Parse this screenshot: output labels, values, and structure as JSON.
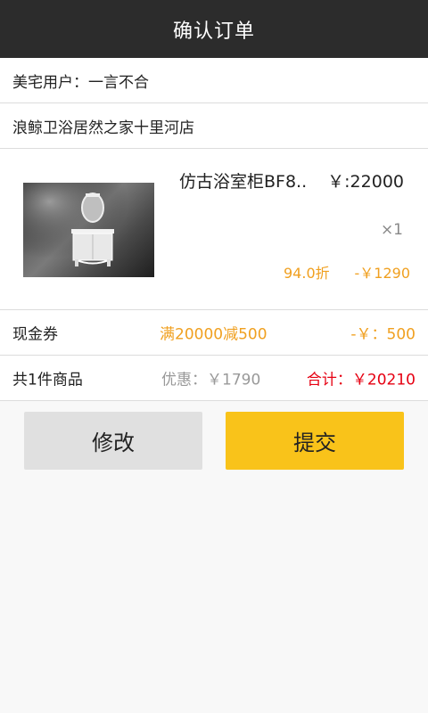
{
  "header": {
    "title": "确认订单"
  },
  "user": {
    "label": "美宅用户：",
    "name": "一言不合"
  },
  "store": {
    "name": "浪鲸卫浴居然之家十里河店"
  },
  "product": {
    "name": "仿古浴室柜BF8..",
    "price": "￥:22000",
    "qty": "×1",
    "discount": "94.0折",
    "discount_amount": "-￥1290"
  },
  "coupon": {
    "label": "现金券",
    "rule": "满20000减500",
    "amount": "-￥：500"
  },
  "total": {
    "count": "共1件商品",
    "saving": "优惠：￥1790",
    "sum": "合计：￥20210"
  },
  "actions": {
    "edit": "修改",
    "submit": "提交"
  },
  "colors": {
    "accent": "#f9c31a",
    "orange": "#f0a020",
    "red": "#e60012",
    "header": "#2c2c2c"
  }
}
